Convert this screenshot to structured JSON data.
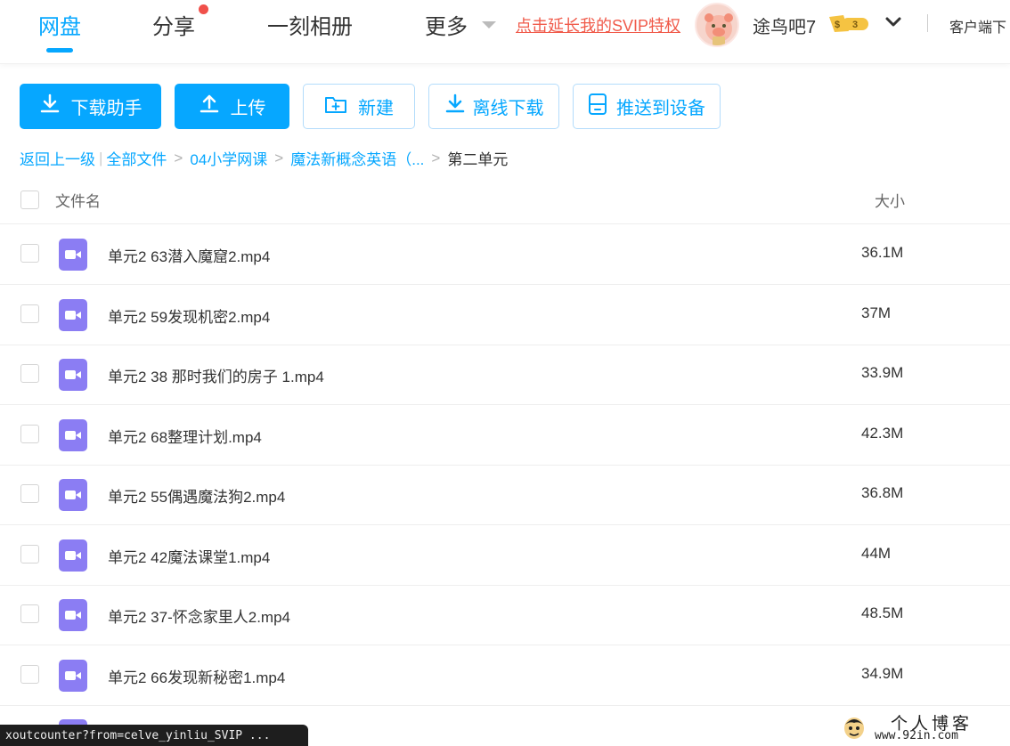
{
  "header": {
    "tabs": [
      {
        "label": "网盘",
        "active": true
      },
      {
        "label": "分享",
        "has_dot": true
      },
      {
        "label": "一刻相册"
      },
      {
        "label": "更多"
      }
    ],
    "svip_link": "点击延长我的SVIP特权",
    "username": "途鸟吧7",
    "vip_level": "3",
    "vip_symbol": "$",
    "client_link": "客户端下"
  },
  "toolbar": {
    "download_helper": "下载助手",
    "upload": "上传",
    "new_folder": "新建",
    "offline_download": "离线下载",
    "push_to_device": "推送到设备"
  },
  "breadcrumb": {
    "back": "返回上一级",
    "separator": "|",
    "items": [
      "全部文件",
      "04小学网课",
      "魔法新概念英语（..."
    ],
    "current": "第二单元"
  },
  "table": {
    "columns": {
      "name": "文件名",
      "size": "大小"
    },
    "rows": [
      {
        "name": "单元2 63潜入魔窟2.mp4",
        "size": "36.1M"
      },
      {
        "name": "单元2 59发现机密2.mp4",
        "size": "37M"
      },
      {
        "name": "单元2 38 那时我们的房子 1.mp4",
        "size": "33.9M"
      },
      {
        "name": "单元2 68整理计划.mp4",
        "size": "42.3M"
      },
      {
        "name": "单元2 55偶遇魔法狗2.mp4",
        "size": "36.8M"
      },
      {
        "name": "单元2 42魔法课堂1.mp4",
        "size": "44M"
      },
      {
        "name": "单元2 37-怀念家里人2.mp4",
        "size": "48.5M"
      },
      {
        "name": "单元2 66发现新秘密1.mp4",
        "size": "34.9M"
      }
    ]
  },
  "status_bar": {
    "text": "xoutcounter?from=celve_yinliu_SVIP ..."
  },
  "watermark": {
    "title": "个人博客",
    "url": "www.92in.com"
  },
  "colors": {
    "accent": "#06a7ff",
    "svip_link": "#f05a4a",
    "video_icon": "#8b7df3",
    "badge": "#f5c342"
  },
  "icons": [
    "download-icon",
    "upload-icon",
    "new-folder-icon",
    "offline-download-icon",
    "device-icon",
    "video-file-icon",
    "chevron-down-icon",
    "caret-down-icon"
  ]
}
